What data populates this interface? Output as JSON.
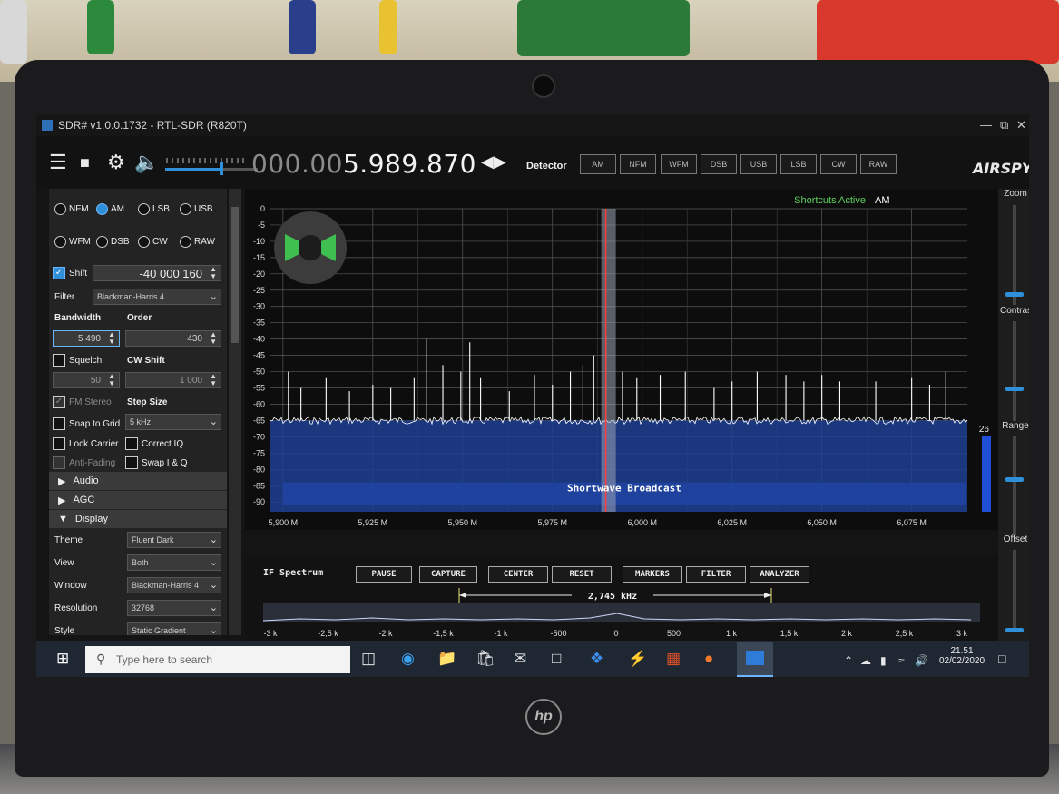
{
  "window": {
    "title": "SDR# v1.0.0.1732 - RTL-SDR (R820T)"
  },
  "toolbar": {
    "frequency_dim": "000.00",
    "frequency_main": "5.989.870",
    "detector_label": "Detector",
    "modes": [
      "AM",
      "NFM",
      "WFM",
      "DSB",
      "USB",
      "LSB",
      "CW",
      "RAW"
    ],
    "brand": "AIRSPY"
  },
  "radio_panel": {
    "modes_row1": [
      "NFM",
      "AM",
      "LSB",
      "USB"
    ],
    "modes_row2": [
      "WFM",
      "DSB",
      "CW",
      "RAW"
    ],
    "selected_mode": "AM",
    "shift_label": "Shift",
    "shift_value": "-40 000 160",
    "filter_label": "Filter",
    "filter_value": "Blackman-Harris 4",
    "bandwidth_label": "Bandwidth",
    "bandwidth_value": "5 490",
    "order_label": "Order",
    "order_value": "430",
    "squelch_label": "Squelch",
    "cw_shift_label": "CW Shift",
    "squelch_value": "50",
    "cw_shift_value": "1 000",
    "fm_stereo_label": "FM Stereo",
    "step_size_label": "Step Size",
    "snap_to_grid_label": "Snap to Grid",
    "step_size_value": "5 kHz",
    "lock_carrier_label": "Lock Carrier",
    "correct_iq_label": "Correct IQ",
    "anti_fading_label": "Anti-Fading",
    "swap_iq_label": "Swap I & Q"
  },
  "sections": {
    "audio": "Audio",
    "agc": "AGC",
    "display": "Display"
  },
  "display_panel": {
    "rows": [
      {
        "label": "Theme",
        "value": "Fluent Dark"
      },
      {
        "label": "View",
        "value": "Both"
      },
      {
        "label": "Window",
        "value": "Blackman-Harris 4"
      },
      {
        "label": "Resolution",
        "value": "32768"
      },
      {
        "label": "Style",
        "value": "Static Gradient"
      }
    ]
  },
  "spectrum": {
    "shortcuts": "Shortcuts Active",
    "mode": "AM",
    "band_label": "Shortwave Broadcast",
    "side_value": "26",
    "y_ticks": [
      "0",
      "-5",
      "-10",
      "-15",
      "-20",
      "-25",
      "-30",
      "-35",
      "-40",
      "-45",
      "-50",
      "-55",
      "-60",
      "-65",
      "-70",
      "-75",
      "-80",
      "-85",
      "-90"
    ],
    "x_ticks": [
      "5,900 M",
      "5,925 M",
      "5,950 M",
      "5,975 M",
      "6,000 M",
      "6,025 M",
      "6,050 M",
      "6,075 M"
    ],
    "peaks": [
      {
        "f": 5.9015,
        "db": -50
      },
      {
        "f": 5.905,
        "db": -55
      },
      {
        "f": 5.912,
        "db": -52
      },
      {
        "f": 5.9185,
        "db": -56
      },
      {
        "f": 5.925,
        "db": -54
      },
      {
        "f": 5.93,
        "db": -55
      },
      {
        "f": 5.9365,
        "db": -52
      },
      {
        "f": 5.94,
        "db": -40
      },
      {
        "f": 5.9445,
        "db": -48
      },
      {
        "f": 5.9495,
        "db": -50
      },
      {
        "f": 5.952,
        "db": -41
      },
      {
        "f": 5.955,
        "db": -52
      },
      {
        "f": 5.963,
        "db": -56
      },
      {
        "f": 5.97,
        "db": -51
      },
      {
        "f": 5.975,
        "db": -54
      },
      {
        "f": 5.98,
        "db": -50
      },
      {
        "f": 5.9835,
        "db": -48
      },
      {
        "f": 5.9865,
        "db": -45
      },
      {
        "f": 5.9899,
        "db": -39
      },
      {
        "f": 5.9945,
        "db": -50
      },
      {
        "f": 5.9985,
        "db": -52
      },
      {
        "f": 6.005,
        "db": -51
      },
      {
        "f": 6.012,
        "db": -50
      },
      {
        "f": 6.02,
        "db": -55
      },
      {
        "f": 6.025,
        "db": -53
      },
      {
        "f": 6.032,
        "db": -50
      },
      {
        "f": 6.04,
        "db": -51
      },
      {
        "f": 6.045,
        "db": -53
      },
      {
        "f": 6.05,
        "db": -51
      },
      {
        "f": 6.055,
        "db": -53
      },
      {
        "f": 6.065,
        "db": -53
      },
      {
        "f": 6.075,
        "db": -52
      },
      {
        "f": 6.08,
        "db": -54
      },
      {
        "f": 6.0845,
        "db": -50
      }
    ]
  },
  "side_controls": {
    "zoom": "Zoom",
    "contrast": "Contrast",
    "range": "Range",
    "offset": "Offset"
  },
  "if_spectrum": {
    "label": "IF Spectrum",
    "buttons": [
      "PAUSE",
      "CAPTURE",
      "CENTER",
      "RESET",
      "MARKERS",
      "FILTER",
      "ANALYZER"
    ],
    "bandwidth": "2,745 kHz",
    "ticks": [
      "-3 k",
      "-2,5 k",
      "-2 k",
      "-1,5 k",
      "-1 k",
      "-500",
      "0",
      "500",
      "1 k",
      "1,5 k",
      "2 k",
      "2,5 k",
      "3 k"
    ]
  },
  "taskbar": {
    "search_placeholder": "Type here to search",
    "time": "21.51",
    "date": "02/02/2020"
  },
  "laptop_brand": "hp",
  "colors": {
    "accent": "#2f8fd8",
    "spectrum_trace": "#ffffff",
    "band": "#1f4fd6",
    "tuner_line": "#ff3b3b"
  }
}
